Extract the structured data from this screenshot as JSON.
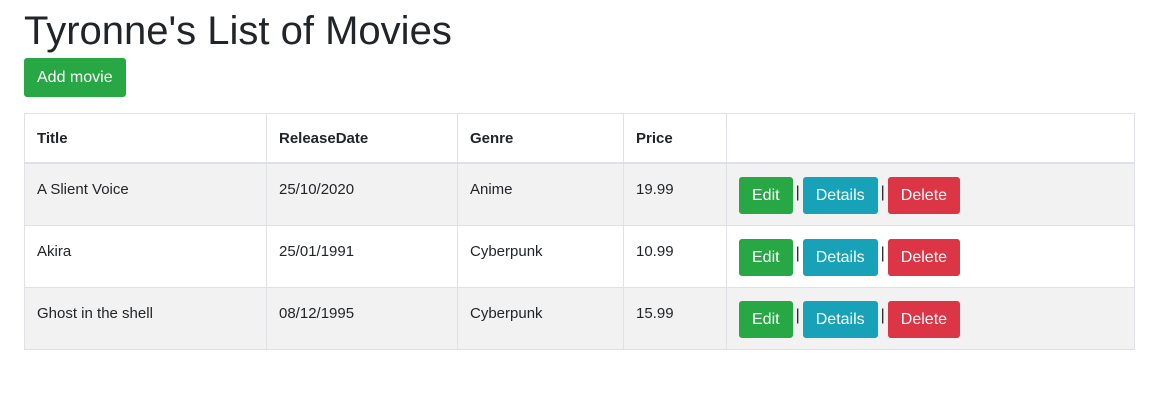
{
  "page": {
    "title": "Tyronne's List of Movies",
    "add_button_label": "Add movie"
  },
  "table": {
    "columns": [
      "Title",
      "ReleaseDate",
      "Genre",
      "Price",
      ""
    ],
    "rows": [
      {
        "title": "A Slient Voice",
        "release_date": "25/10/2020",
        "genre": "Anime",
        "price": "19.99"
      },
      {
        "title": "Akira",
        "release_date": "25/01/1991",
        "genre": "Cyberpunk",
        "price": "10.99"
      },
      {
        "title": "Ghost in the shell",
        "release_date": "08/12/1995",
        "genre": "Cyberpunk",
        "price": "15.99"
      }
    ],
    "actions": {
      "edit_label": "Edit",
      "details_label": "Details",
      "delete_label": "Delete",
      "separator": "|"
    }
  },
  "colors": {
    "success": "#28a745",
    "info": "#17a2b8",
    "danger": "#dc3545",
    "stripe": "#f2f2f2"
  }
}
